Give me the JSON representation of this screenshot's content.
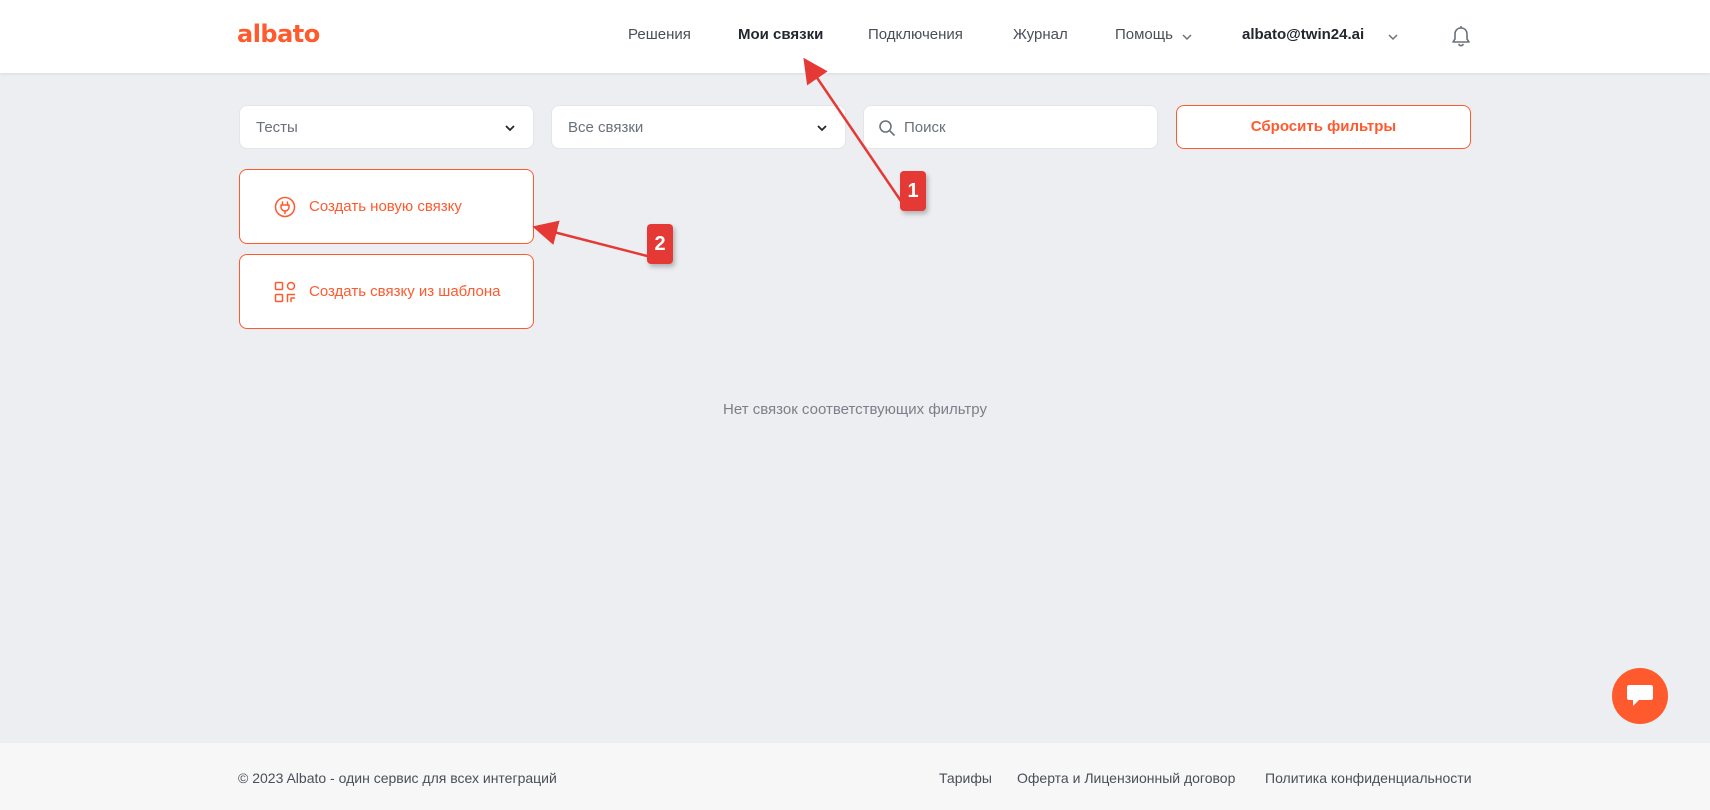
{
  "header": {
    "logo": "albato",
    "nav": [
      {
        "label": "Решения"
      },
      {
        "label": "Мои связки"
      },
      {
        "label": "Подключения"
      },
      {
        "label": "Журнал"
      },
      {
        "label": "Помощь"
      }
    ],
    "user_email": "albato@twin24.ai"
  },
  "filters": {
    "folder": "Тесты",
    "status": "Все связки",
    "search_placeholder": "Поиск",
    "reset_label": "Сбросить фильтры"
  },
  "actions": {
    "create_new": "Создать новую связку",
    "create_from_template": "Создать связку из шаблона"
  },
  "empty_message": "Нет связок соответствующих фильтру",
  "annotations": {
    "badge_1": "1",
    "badge_2": "2"
  },
  "footer": {
    "copyright": "© 2023 Albato - один сервис для всех интеграций",
    "links": [
      "Тарифы",
      "Оферта и Лицензионный договор",
      "Политика конфиденциальности"
    ]
  },
  "colors": {
    "accent": "#ff5a2e",
    "annotation": "#e53935",
    "background": "#edeef1"
  }
}
